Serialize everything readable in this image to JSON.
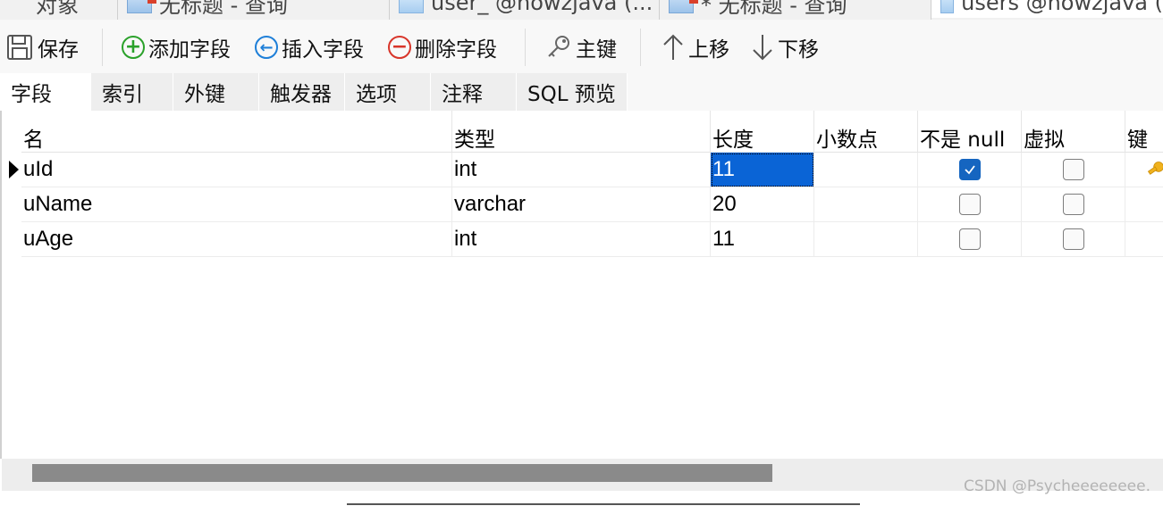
{
  "doc_tabs": [
    {
      "label": "对象",
      "icon": "none"
    },
    {
      "label": "无标题 - 查询",
      "icon": "query-icon"
    },
    {
      "label": "user_ @howzjava (...",
      "icon": "table-icon"
    },
    {
      "label": "* 无标题 - 查询",
      "icon": "query-icon"
    },
    {
      "label": "users @howzjava (",
      "icon": "table-design-icon"
    }
  ],
  "toolbar": {
    "save": "保存",
    "add_field": "添加字段",
    "insert_field": "插入字段",
    "delete_field": "删除字段",
    "primary_key": "主键",
    "move_up": "上移",
    "move_down": "下移"
  },
  "subtabs": [
    "字段",
    "索引",
    "外键",
    "触发器",
    "选项",
    "注释",
    "SQL 预览"
  ],
  "grid": {
    "columns": [
      "名",
      "类型",
      "长度",
      "小数点",
      "不是 null",
      "虚拟",
      "键"
    ],
    "rows": [
      {
        "name": "uId",
        "type": "int",
        "length": "11",
        "decimals": "",
        "not_null": true,
        "virtual": false,
        "key": true
      },
      {
        "name": "uName",
        "type": "varchar",
        "length": "20",
        "decimals": "",
        "not_null": false,
        "virtual": false,
        "key": false
      },
      {
        "name": "uAge",
        "type": "int",
        "length": "11",
        "decimals": "",
        "not_null": false,
        "virtual": false,
        "key": false
      }
    ]
  },
  "watermark": "CSDN @Psycheeeeeeee.",
  "colors": {
    "accent": "#0a64d6",
    "add": "#2aa12a",
    "insert": "#1e7fd8",
    "delete": "#d8352a",
    "key": "#e8a317"
  }
}
